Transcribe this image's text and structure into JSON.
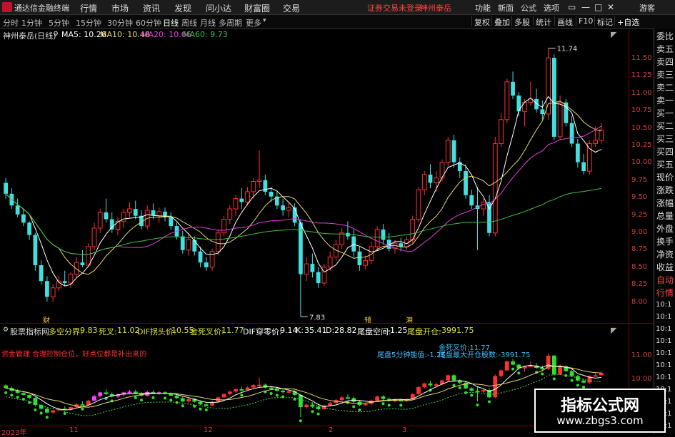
{
  "menubar": {
    "app_title": "通达信金融终端",
    "items": [
      "行情",
      "市场",
      "资讯",
      "发现",
      "问小达",
      "财富圈",
      "交易"
    ],
    "status": "证券交易未登录",
    "stock_name": "神州泰岳",
    "right_items": [
      "功能",
      "新面",
      "公式",
      "选项"
    ],
    "guest": "游客"
  },
  "toolbar": {
    "timeframes": [
      "分时",
      "1分钟",
      "5分钟",
      "15分钟",
      "30分钟",
      "60分钟",
      "日线",
      "周线",
      "月线",
      "多周期",
      "更多"
    ],
    "active": "日线",
    "right_buttons": [
      "复权",
      "叠加",
      "多股",
      "统计",
      "画线",
      "F10",
      "标记",
      "+自选"
    ]
  },
  "ma_bar": {
    "title": "神州泰岳(日线)",
    "ma5": "MA5: 10.26",
    "ma10": "MA10: 10.48",
    "ma20": "MA20: 10.66",
    "ma60": "MA60: 9.73",
    "colors": {
      "ma5": "#ffffff",
      "ma10": "#e6d96e",
      "ma20": "#e040e0",
      "ma60": "#40c040"
    }
  },
  "main_chart": {
    "high_label": "11.74",
    "low_label": "7.83",
    "markers": [
      "财",
      "预",
      "港"
    ],
    "up_color": "#ff3030",
    "down_color": "#40e0e0"
  },
  "yaxis_ticks": [
    "11.50",
    "11.25",
    "11.00",
    "10.75",
    "10.50",
    "10.25",
    "10.00",
    "9.75",
    "9.50",
    "9.25",
    "9.00",
    "8.75",
    "8.50",
    "8.25",
    "8.00"
  ],
  "yaxis_ind_ticks": [
    "11.00",
    "10.00"
  ],
  "yaxis_times": [
    "10:1",
    "10:1",
    "10:1",
    "10:1",
    "10:1",
    "10:1",
    "10:1",
    "10:1",
    "10:1",
    "10:1",
    "10:1"
  ],
  "ind_bar": {
    "name": "股票指标网",
    "items": [
      {
        "label": "多空分界:",
        "value": "9.83",
        "color": "#e0e040"
      },
      {
        "label": "死叉:",
        "value": "11.02",
        "color": "#e0e040"
      },
      {
        "label": "DIF拐头价:",
        "value": "10.55",
        "color": "#e0e040"
      },
      {
        "label": "金死叉价:",
        "value": "11.77",
        "color": "#e0e040"
      },
      {
        "label": "DIF穿零价:",
        "value": "9.14",
        "color": "#ffffff"
      },
      {
        "label": "K:",
        "value": "35.41",
        "color": "#ffffff"
      },
      {
        "label": "D:",
        "value": "28.82",
        "color": "#ffffff"
      },
      {
        "label": "尾盘空间:",
        "value": "-1.25",
        "color": "#ffffff"
      },
      {
        "label": "尾盘开仓:",
        "value": "-3991.75",
        "color": "#e0e040"
      }
    ]
  },
  "ind_chart": {
    "note_red": "资金管理 合理控制仓位，好点位都是补出来的",
    "label_tail5": "尾盘5分钟能值:",
    "label_tail5_val": "-1.25",
    "label_gold": "金死叉价:",
    "label_gold_val": "11.77",
    "label_tail_open": "尾盘最大开仓股数:",
    "label_tail_open_val": "-3991.75"
  },
  "right_panel": [
    "委比",
    "卖五",
    "卖四",
    "卖三",
    "卖二",
    "卖一",
    "买一",
    "买二",
    "买三",
    "买四",
    "买五",
    "现价",
    "涨跌",
    "涨幅",
    "总量",
    "外盘",
    "换手",
    "净资",
    "收益",
    "自动",
    "行情"
  ],
  "xaxis": {
    "labels": [
      "2023年",
      "11",
      "12",
      "2",
      "3"
    ]
  },
  "watermark": {
    "title": "指标公式网",
    "url": "www.zbgs3.com"
  },
  "chart_data": {
    "type": "candlestick",
    "ylim": [
      7.75,
      11.85
    ],
    "candles": [
      [
        9.78,
        9.85,
        9.55,
        9.62
      ],
      [
        9.62,
        9.7,
        9.4,
        9.45
      ],
      [
        9.45,
        9.55,
        9.28,
        9.32
      ],
      [
        9.32,
        9.4,
        9.15,
        9.2
      ],
      [
        9.2,
        9.22,
        8.95,
        9.02
      ],
      [
        9.02,
        9.05,
        8.5,
        8.58
      ],
      [
        8.58,
        8.65,
        8.3,
        8.35
      ],
      [
        8.35,
        8.42,
        8.05,
        8.12
      ],
      [
        8.12,
        8.3,
        8.05,
        8.25
      ],
      [
        8.25,
        8.42,
        8.2,
        8.35
      ],
      [
        8.35,
        8.5,
        8.28,
        8.32
      ],
      [
        8.32,
        8.48,
        8.25,
        8.45
      ],
      [
        8.45,
        8.7,
        8.4,
        8.62
      ],
      [
        8.62,
        8.8,
        8.55,
        8.58
      ],
      [
        8.58,
        8.9,
        8.55,
        8.85
      ],
      [
        8.85,
        9.2,
        8.8,
        9.12
      ],
      [
        9.12,
        9.4,
        9.05,
        9.35
      ],
      [
        9.35,
        9.55,
        9.2,
        9.25
      ],
      [
        9.25,
        9.35,
        9.05,
        9.1
      ],
      [
        9.1,
        9.28,
        9.02,
        9.22
      ],
      [
        9.22,
        9.4,
        9.12,
        9.35
      ],
      [
        9.35,
        9.5,
        9.28,
        9.4
      ],
      [
        9.4,
        9.52,
        9.25,
        9.3
      ],
      [
        9.3,
        9.38,
        9.1,
        9.15
      ],
      [
        9.15,
        9.45,
        9.1,
        9.38
      ],
      [
        9.38,
        9.48,
        9.25,
        9.3
      ],
      [
        9.3,
        9.42,
        9.2,
        9.36
      ],
      [
        9.36,
        9.42,
        9.22,
        9.28
      ],
      [
        9.28,
        9.35,
        9.1,
        9.15
      ],
      [
        9.15,
        9.2,
        8.95,
        9.0
      ],
      [
        9.0,
        9.08,
        8.75,
        8.8
      ],
      [
        8.8,
        9.05,
        8.72,
        8.95
      ],
      [
        8.95,
        9.0,
        8.72,
        8.78
      ],
      [
        8.78,
        8.85,
        8.55,
        8.62
      ],
      [
        8.62,
        8.7,
        8.5,
        8.55
      ],
      [
        8.55,
        8.82,
        8.5,
        8.78
      ],
      [
        8.78,
        9.1,
        8.72,
        9.05
      ],
      [
        9.05,
        9.3,
        9.0,
        9.25
      ],
      [
        9.25,
        9.45,
        9.18,
        9.4
      ],
      [
        9.4,
        9.6,
        9.3,
        9.55
      ],
      [
        9.55,
        9.7,
        9.4,
        9.5
      ],
      [
        9.5,
        9.72,
        9.45,
        9.65
      ],
      [
        9.65,
        9.85,
        9.55,
        9.8
      ],
      [
        9.8,
        10.25,
        9.7,
        9.82
      ],
      [
        9.82,
        9.9,
        9.6,
        9.65
      ],
      [
        9.65,
        9.72,
        9.5,
        9.58
      ],
      [
        9.58,
        9.65,
        9.4,
        9.45
      ],
      [
        9.45,
        9.55,
        9.3,
        9.38
      ],
      [
        9.38,
        9.5,
        9.28,
        9.42
      ],
      [
        9.42,
        9.48,
        9.15,
        9.2
      ],
      [
        9.2,
        9.25,
        7.83,
        8.45
      ],
      [
        8.45,
        8.7,
        8.35,
        8.6
      ],
      [
        8.6,
        8.75,
        8.4,
        8.48
      ],
      [
        8.48,
        8.55,
        8.25,
        8.32
      ],
      [
        8.32,
        8.6,
        8.28,
        8.55
      ],
      [
        8.55,
        8.78,
        8.5,
        8.7
      ],
      [
        8.7,
        8.95,
        8.65,
        8.88
      ],
      [
        8.88,
        9.12,
        8.82,
        9.05
      ],
      [
        9.05,
        9.22,
        8.95,
        9.0
      ],
      [
        9.0,
        9.1,
        8.7,
        8.78
      ],
      [
        8.78,
        8.85,
        8.5,
        8.58
      ],
      [
        8.58,
        8.72,
        8.52,
        8.65
      ],
      [
        8.65,
        8.92,
        8.6,
        8.85
      ],
      [
        8.85,
        9.15,
        8.8,
        9.1
      ],
      [
        9.1,
        9.18,
        8.88,
        8.95
      ],
      [
        8.95,
        9.05,
        8.78,
        8.82
      ],
      [
        8.82,
        8.95,
        8.75,
        8.9
      ],
      [
        8.9,
        8.98,
        8.78,
        8.85
      ],
      [
        8.85,
        9.0,
        8.8,
        8.95
      ],
      [
        8.95,
        9.3,
        8.9,
        9.25
      ],
      [
        9.25,
        9.72,
        9.2,
        9.68
      ],
      [
        9.68,
        9.95,
        9.6,
        9.9
      ],
      [
        9.9,
        10.05,
        9.7,
        9.78
      ],
      [
        9.78,
        9.95,
        9.65,
        9.85
      ],
      [
        9.85,
        10.12,
        9.8,
        10.08
      ],
      [
        10.08,
        10.45,
        10.0,
        10.4
      ],
      [
        10.4,
        10.48,
        10.0,
        10.08
      ],
      [
        10.08,
        10.15,
        9.85,
        9.95
      ],
      [
        9.95,
        10.05,
        9.55,
        9.6
      ],
      [
        9.6,
        9.68,
        9.4,
        9.45
      ],
      [
        9.45,
        9.72,
        8.8,
        9.4
      ],
      [
        9.4,
        9.55,
        9.3,
        9.5
      ],
      [
        9.5,
        9.6,
        9.0,
        9.05
      ],
      [
        9.05,
        10.45,
        9.0,
        10.35
      ],
      [
        10.35,
        10.8,
        10.3,
        10.7
      ],
      [
        10.7,
        11.3,
        10.65,
        11.25
      ],
      [
        11.25,
        11.4,
        11.0,
        11.05
      ],
      [
        11.05,
        11.1,
        10.75,
        10.82
      ],
      [
        10.82,
        11.0,
        10.6,
        10.95
      ],
      [
        10.95,
        11.25,
        10.9,
        11.0
      ],
      [
        11.0,
        11.15,
        10.8,
        10.85
      ],
      [
        10.85,
        10.98,
        10.7,
        10.78
      ],
      [
        10.78,
        11.74,
        10.7,
        11.6
      ],
      [
        11.6,
        11.65,
        10.4,
        10.45
      ],
      [
        10.45,
        11.05,
        10.4,
        10.95
      ],
      [
        10.95,
        11.0,
        10.6,
        10.65
      ],
      [
        10.65,
        10.75,
        10.3,
        10.35
      ],
      [
        10.35,
        10.42,
        10.0,
        10.08
      ],
      [
        10.08,
        10.2,
        9.9,
        9.95
      ],
      [
        9.95,
        10.4,
        9.9,
        10.35
      ],
      [
        10.35,
        10.6,
        10.3,
        10.4
      ],
      [
        10.4,
        10.65,
        10.35,
        10.55
      ]
    ]
  }
}
